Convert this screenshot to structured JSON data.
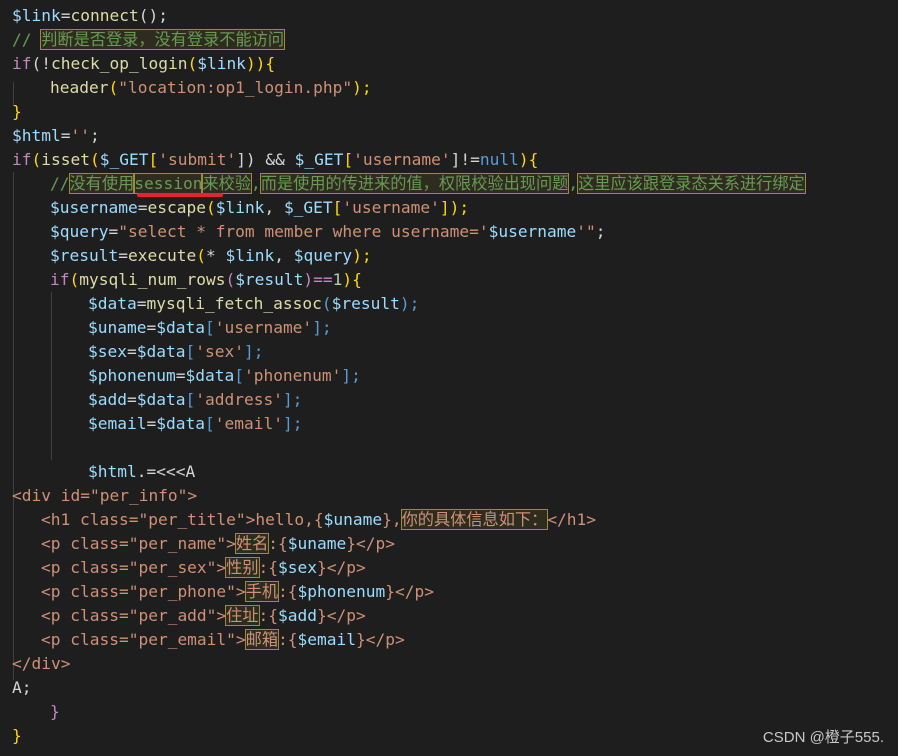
{
  "code": {
    "l1": {
      "a": "$link",
      "b": "=",
      "c": "connect",
      "d": "();"
    },
    "l2": {
      "a": "// ",
      "b": "判断是否登录，没有登录不能访问"
    },
    "l3": {
      "a": "if",
      "b": "(!",
      "c": "check_op_login",
      "d": "(",
      "e": "$link",
      "f": ")){"
    },
    "l4": {
      "a": "header",
      "b": "(",
      "c": "\"location:op1_login.php\"",
      "d": ");"
    },
    "l5": {
      "a": "}"
    },
    "l6": {
      "a": "$html",
      "b": "=",
      "c": "''",
      "d": ";"
    },
    "l7": {
      "a": "if",
      "b": "(",
      "c": "isset",
      "d": "(",
      "e": "$_GET",
      "f": "[",
      "g": "'submit'",
      "h": "]) && ",
      "i": "$_GET",
      "j": "[",
      "k": "'username'",
      "l": "]!=",
      "m": "null",
      "n": "){"
    },
    "l8": {
      "a": "//",
      "b": "没有使用",
      "c": "session",
      "d": "来校验",
      "e": ",",
      "f": "而是使用的传进来的值，权限校验出现问题",
      "g": ",",
      "h": "这里应该跟登录态关系进行绑定"
    },
    "l9": {
      "a": "$username",
      "b": "=",
      "c": "escape",
      "d": "(",
      "e": "$link",
      "f": ", ",
      "g": "$_GET",
      "h": "[",
      "i": "'username'",
      "j": "]);"
    },
    "l10": {
      "a": "$query",
      "b": "=",
      "c": "\"select * from member where username='",
      "d": "$username",
      "e": "'\"",
      "f": ";"
    },
    "l11": {
      "a": "$result",
      "b": "=",
      "c": "execute",
      "d": "(",
      "e": "*",
      "f": " ",
      "g": "$link",
      "h": ", ",
      "i": "$query",
      "j": ");"
    },
    "l12": {
      "a": "if",
      "b": "(",
      "c": "mysqli_num_rows",
      "d": "(",
      "e": "$result",
      "f": ")==",
      "g": "1",
      "h": "){"
    },
    "l13": {
      "a": "$data",
      "b": "=",
      "c": "mysqli_fetch_assoc",
      "d": "(",
      "e": "$result",
      "f": ");"
    },
    "l14": {
      "a": "$uname",
      "b": "=",
      "c": "$data",
      "d": "[",
      "e": "'username'",
      "f": "];"
    },
    "l15": {
      "a": "$sex",
      "b": "=",
      "c": "$data",
      "d": "[",
      "e": "'sex'",
      "f": "];"
    },
    "l16": {
      "a": "$phonenum",
      "b": "=",
      "c": "$data",
      "d": "[",
      "e": "'phonenum'",
      "f": "];"
    },
    "l17": {
      "a": "$add",
      "b": "=",
      "c": "$data",
      "d": "[",
      "e": "'address'",
      "f": "];"
    },
    "l18": {
      "a": "$email",
      "b": "=",
      "c": "$data",
      "d": "[",
      "e": "'email'",
      "f": "];"
    },
    "l20": {
      "a": "$html",
      "b": ".=<<<A"
    },
    "l21": {
      "a": "<div id=\"per_info\">"
    },
    "l22": {
      "a": "<h1 class=\"per_title\">hello,{",
      "b": "$uname",
      "c": "},",
      "d": "你的具体信息如下：",
      "e": "</h1>"
    },
    "l23": {
      "a": "<p class=\"per_name\">",
      "b": "姓名",
      "c": ":{",
      "d": "$uname",
      "e": "}</p>"
    },
    "l24": {
      "a": "<p class=\"per_sex\">",
      "b": "性别",
      "c": ":{",
      "d": "$sex",
      "e": "}</p>"
    },
    "l25": {
      "a": "<p class=\"per_phone\">",
      "b": "手机",
      "c": ":{",
      "d": "$phonenum",
      "e": "}</p>"
    },
    "l26": {
      "a": "<p class=\"per_add\">",
      "b": "住址",
      "c": ":{",
      "d": "$add",
      "e": "}</p>"
    },
    "l27": {
      "a": "<p class=\"per_email\">",
      "b": "邮箱",
      "c": ":{",
      "d": "$email",
      "e": "}</p>"
    },
    "l28": {
      "a": "</div>"
    },
    "l29": {
      "a": "A;"
    },
    "l30": {
      "a": "}"
    },
    "l31": {
      "a": "}"
    }
  },
  "watermark": "CSDN @橙子555.",
  "colors": {
    "background": "#1e1e1e",
    "variable": "#9cdcfe",
    "function": "#dcdcaa",
    "keyword": "#c586c0",
    "string": "#ce9178",
    "comment": "#6a9955",
    "number": "#b5cea8",
    "literal": "#569cd6",
    "highlight_border": "#9b8b3c",
    "underline_mark": "#e8232a"
  }
}
